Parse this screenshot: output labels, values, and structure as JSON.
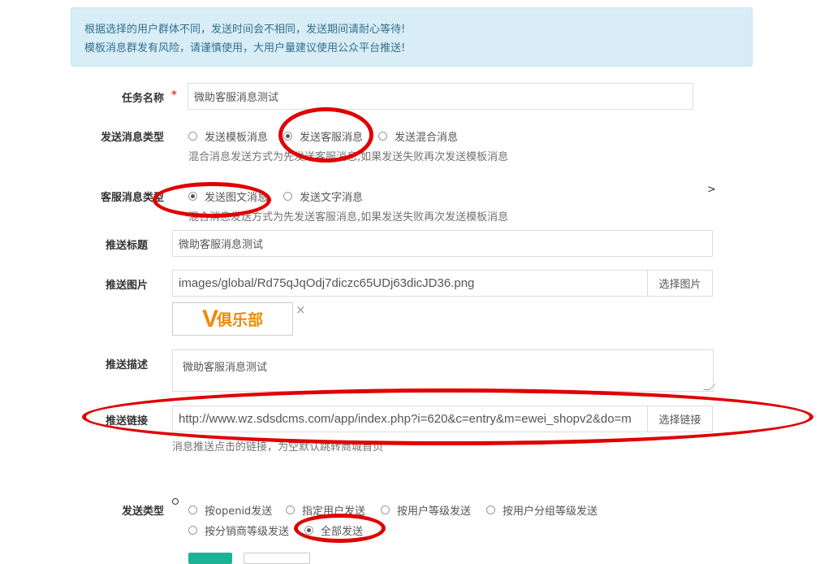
{
  "notice": {
    "line1": "根据选择的用户群体不同，发送时间会不相同，发送期间请耐心等待!",
    "line2": "模板消息群发有风险，请谨慎使用，大用户量建议使用公众平台推送!"
  },
  "task_name": {
    "label": "任务名称",
    "required_mark": "*",
    "value": "微助客服消息测试"
  },
  "send_msg_type": {
    "label": "发送消息类型",
    "options": [
      "发送模板消息",
      "发送客服消息",
      "发送混合消息"
    ],
    "selected": "发送客服消息",
    "help": "混合消息发送方式为先发送客服消息,如果发送失败再次发送模板消息"
  },
  "cs_msg_type": {
    "label": "客服消息类型",
    "options": [
      "发送图文消息",
      "发送文字消息"
    ],
    "selected": "发送图文消息",
    "help": "混合消息发送方式为先发送客服消息,如果发送失败再次发送模板消息",
    "side_marker": ">"
  },
  "push_title": {
    "label": "推送标题",
    "value": "微助客服消息测试"
  },
  "push_image": {
    "label": "推送图片",
    "value": "images/global/Rd75qJqOdj7diczc65UDj63dicJD36.png",
    "button": "选择图片",
    "logo_text": "俱乐部",
    "logo_letter": "V",
    "remove_icon": "×"
  },
  "push_desc": {
    "label": "推送描述",
    "value": "微助客服消息测试"
  },
  "push_link": {
    "label": "推送链接",
    "value": "http://www.wz.sdsdcms.com/app/index.php?i=620&c=entry&m=ewei_shopv2&do=m",
    "button": "选择链接",
    "help": "消息推送点击的链接，为空默认跳转商城首页"
  },
  "send_type": {
    "label": "发送类型",
    "options": [
      "按openid发送",
      "指定用户发送",
      "按用户等级发送",
      "按用户分组等级发送",
      "按分销商等级发送",
      "全部发送"
    ],
    "selected": "全部发送"
  },
  "colors": {
    "annotation": "#e00000",
    "notice_bg": "#d9edf7",
    "primary": "#1ab394"
  }
}
